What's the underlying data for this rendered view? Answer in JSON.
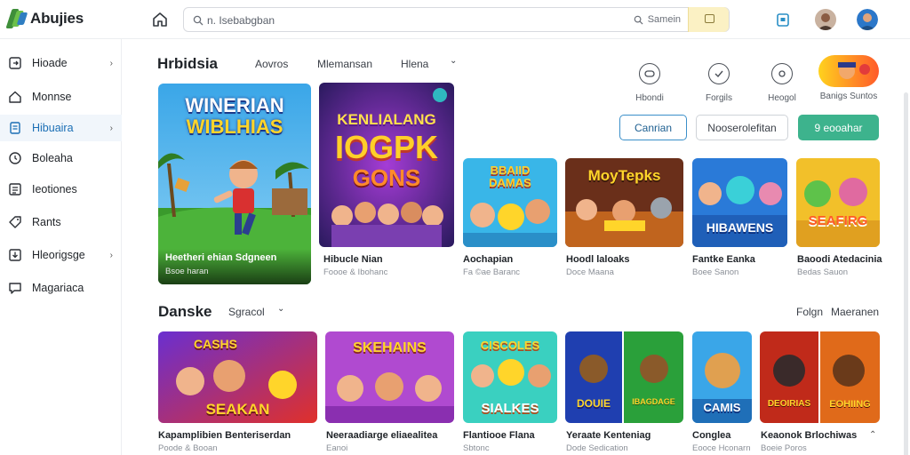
{
  "app": {
    "name": "Abujies"
  },
  "search": {
    "placeholder": "n. Isebabgban",
    "button_label": "Samein"
  },
  "sidebar": {
    "items": [
      {
        "label": "Hioade",
        "icon": "square-login-icon",
        "chevron": "›"
      },
      {
        "label": "Monnse",
        "icon": "home-icon",
        "chevron": ""
      },
      {
        "label": "Hibuaira",
        "icon": "document-icon",
        "chevron": "›"
      },
      {
        "label": "Boleaha",
        "icon": "clock-icon",
        "chevron": ""
      },
      {
        "label": "Ieotiones",
        "icon": "list-icon",
        "chevron": ""
      },
      {
        "label": "Rants",
        "icon": "tag-icon",
        "chevron": ""
      },
      {
        "label": "Hleorigsge",
        "icon": "download-icon",
        "chevron": "›"
      },
      {
        "label": "Magariaca",
        "icon": "message-icon",
        "chevron": ""
      }
    ]
  },
  "section1": {
    "title": "Hrbidsia",
    "tabs": [
      "Aovros",
      "Mlemansan",
      "Hlena"
    ],
    "tab_chevron": "⌄",
    "quick_actions": [
      {
        "label": "Hbondi",
        "icon": "gamepad-icon"
      },
      {
        "label": "Forgils",
        "icon": "check-circle-icon"
      },
      {
        "label": "Heogol",
        "icon": "at-sign-icon"
      },
      {
        "label": "Banigs Suntos",
        "icon": "game-art-icon"
      }
    ],
    "buttons": {
      "primary_outline": "Canrian",
      "secondary": "Nooserolefitan",
      "teal": "9 eooahar"
    },
    "featured": {
      "cover_line1": "WINERIAN",
      "cover_line2": "WIBLHIAS",
      "title": "Heetheri ehian Sdgneen",
      "sub": "Bsoe haran"
    },
    "cards": [
      {
        "cover_text_1": "KENLIALANG",
        "cover_text_2": "IOGPK",
        "cover_text_3": "GONS",
        "title": "Hibucle  Nian",
        "sub": "Foooe & Ibohanc"
      },
      {
        "cover_text_1": "BBAIID",
        "cover_text_2": "DAMAS",
        "title": "Aochapian",
        "sub": "Fa ©ae Baranc"
      },
      {
        "cover_text_1": "MoyTepks",
        "title": "Hoodl laloaks",
        "sub": "Doce Maana"
      },
      {
        "cover_text_1": "HIBAWENS",
        "title": "Fantke Eanka",
        "sub": "Boee Sanon"
      },
      {
        "cover_text_1": "SEAFIRG",
        "title": "Baoodi Atedacinia",
        "sub": "Bedas Sauon"
      }
    ]
  },
  "section2": {
    "title": "Danske",
    "filter_label": "Sgracol",
    "filter_chevron": "⌄",
    "right_links": [
      "Folgn",
      "Maeranen"
    ],
    "cards": [
      {
        "cover_text_1": "CASHS",
        "cover_text_2": "SEAKAN",
        "title": "Kapamplibien Benteriserdan",
        "sub": "Poode & Booan"
      },
      {
        "cover_text_1": "SKEHAINS",
        "title": "Neeraadiarge eliaealitea",
        "sub": "Eanoi"
      },
      {
        "cover_text_1": "CISCOLES",
        "cover_text_2": "SIALKES",
        "title": "Flantiooe Flana",
        "sub": "Sbtonc"
      },
      {
        "cover_text_1": "DOUIE",
        "cover_text_2": "IBAGDAGE",
        "title": "Yeraate Kenteniag",
        "sub": "Dode Sedication"
      },
      {
        "cover_text_1": "CAMIS",
        "title": "Conglea",
        "sub": "Eooce Hconarn"
      },
      {
        "cover_text_1": "DEOIRIAS",
        "cover_text_2": "EOHIING",
        "title": "Keaonok Brlochiwas",
        "sub": "Boeie Poros",
        "more": "⌃"
      }
    ]
  },
  "colors": {
    "accent_blue": "#1b6fb5",
    "teal": "#3db38d",
    "search_yellow": "#fbf1c4"
  }
}
